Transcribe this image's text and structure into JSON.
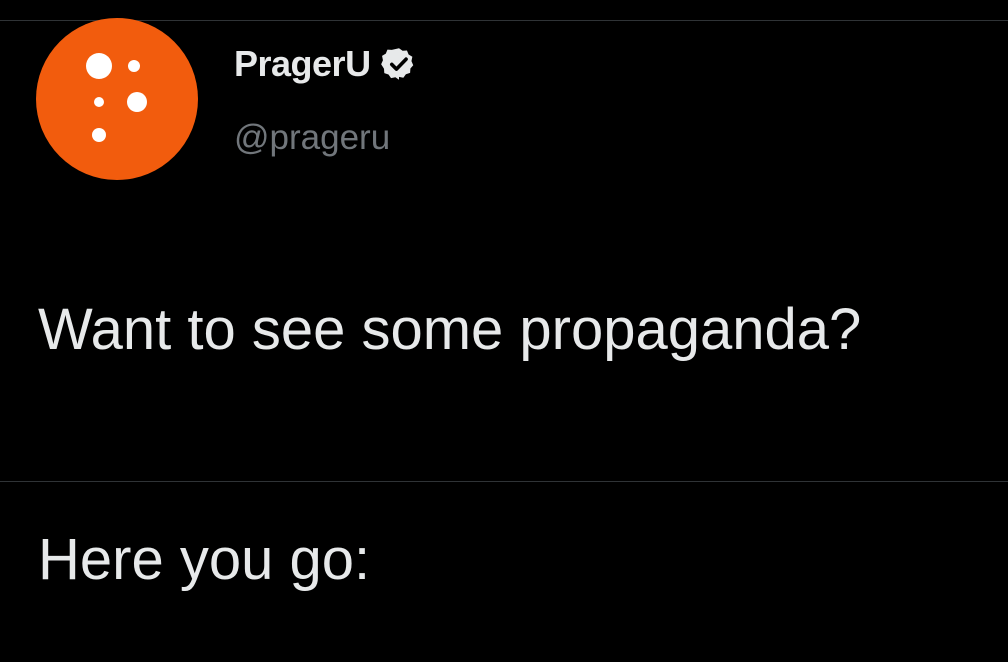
{
  "tweet": {
    "author": {
      "display_name": "PragerU",
      "handle": "@prageru",
      "verified": true,
      "avatar_icon": "prageru-logo-icon",
      "avatar_color": "#f25c0d"
    },
    "text_lines": [
      "Want to see some propaganda?",
      "Here you go:"
    ]
  },
  "colors": {
    "background": "#000000",
    "primary_text": "#e7e9ea",
    "secondary_text": "#71767b",
    "divider": "#2f3336",
    "verified_badge": "#e7e9ea"
  }
}
